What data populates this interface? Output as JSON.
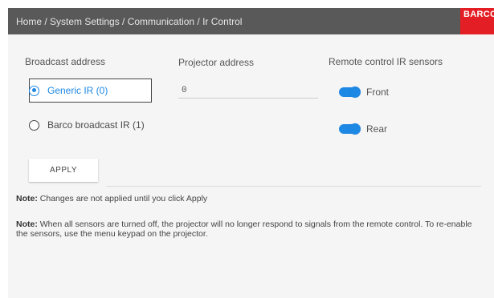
{
  "header": {
    "breadcrumb": "Home / System Settings / Communication / Ir Control",
    "brand": "BARCO"
  },
  "broadcast": {
    "title": "Broadcast address",
    "options": [
      {
        "label": "Generic IR (0)",
        "selected": true
      },
      {
        "label": "Barco broadcast IR (1)",
        "selected": false
      }
    ]
  },
  "projector": {
    "title": "Projector address",
    "value": "0"
  },
  "sensors": {
    "title": "Remote control IR sensors",
    "items": [
      {
        "label": "Front",
        "on": true
      },
      {
        "label": "Rear",
        "on": true
      }
    ]
  },
  "actions": {
    "apply_label": "APPLY"
  },
  "notes": {
    "prefix": "Note:",
    "note1": "Changes are not applied until you click Apply",
    "note2": "When all sensors are turned off, the projector will no longer respond to signals from the remote control. To re-enable the sensors, use the menu keypad on the projector."
  },
  "colors": {
    "header_bg": "#595959",
    "brand_red": "#e31e24",
    "accent_blue": "#1e88e5",
    "panel_bg": "#f5f5f5"
  }
}
